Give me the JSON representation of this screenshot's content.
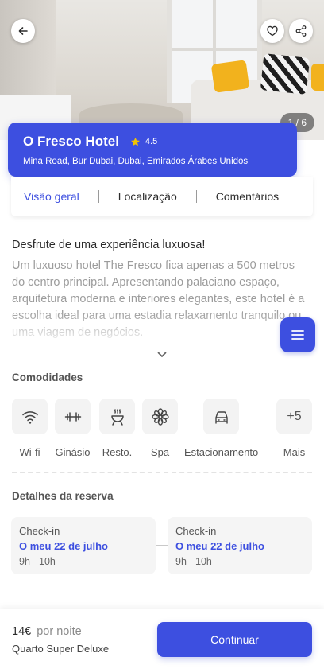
{
  "hero": {
    "photo_counter": "1 / 6"
  },
  "hotel": {
    "name": "O Fresco Hotel",
    "rating": "4.5",
    "address": "Mina Road, Bur Dubai, Dubai, Emirados Árabes Unidos"
  },
  "tabs": [
    {
      "label": "Visão geral",
      "active": true
    },
    {
      "label": "Localização",
      "active": false
    },
    {
      "label": "Comentários",
      "active": false
    }
  ],
  "description": {
    "title": "Desfrute de uma experiência luxuosa!",
    "body": "Um luxuoso hotel The Fresco fica apenas a 500 metros do centro principal. Apresentando palaciano espaço, arquitetura moderna e interiores elegantes, este hotel é a escolha ideal para uma estadia relaxamento tranquilo ou uma viagem de negócios."
  },
  "amenities": {
    "title": "Comodidades",
    "items": [
      {
        "label": "Wi-fi",
        "icon": "wifi-icon"
      },
      {
        "label": "Ginásio",
        "icon": "dumbbell-icon"
      },
      {
        "label": "Resto.",
        "icon": "grill-icon"
      },
      {
        "label": "Spa",
        "icon": "flower-icon"
      },
      {
        "label": "Estacionamento",
        "icon": "car-icon"
      }
    ],
    "more": {
      "count": "+5",
      "label": "Mais"
    }
  },
  "booking": {
    "title": "Detalhes da reserva",
    "left": {
      "label": "Check-in",
      "date": "O meu 22 de julho",
      "time": "9h - 10h"
    },
    "right": {
      "label": "Check-in",
      "date": "O meu 22 de julho",
      "time": "9h - 10h"
    }
  },
  "footer": {
    "price": "14€",
    "per_night": "por noite",
    "room": "Quarto Super Deluxe",
    "cta": "Continuar"
  },
  "colors": {
    "accent": "#3d4fe0",
    "star": "#f2c200"
  }
}
